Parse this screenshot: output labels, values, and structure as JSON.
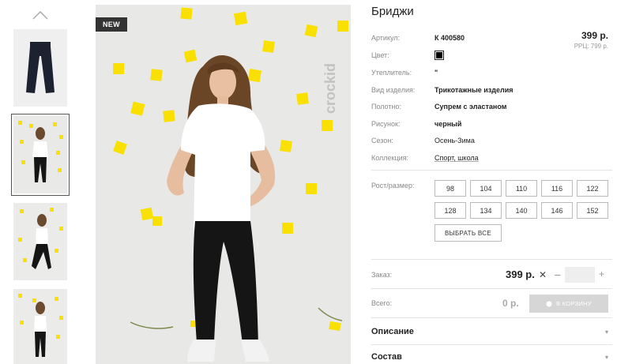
{
  "badge": "NEW",
  "brand_vertical": "crockid",
  "product": {
    "title": "Бриджи",
    "price": "399 р.",
    "rrp": "РРЦ: 799 р."
  },
  "specs": {
    "article_label": "Артикул:",
    "article_value": "К 400580",
    "color_label": "Цвет:",
    "color_hex": "#000000",
    "insulation_label": "Утеплитель:",
    "insulation_value": "\"",
    "type_label": "Вид изделия:",
    "type_value": "Трикотажные изделия",
    "fabric_label": "Полотно:",
    "fabric_value": "Супрем с эластаном",
    "pattern_label": "Рисунок:",
    "pattern_value": "черный",
    "season_label": "Сезон:",
    "season_value": "Осень-Зима",
    "collection_label": "Коллекция:",
    "collection_value": "Спорт, школа"
  },
  "sizes": {
    "label": "Рост/размер:",
    "items": [
      "98",
      "104",
      "110",
      "116",
      "122",
      "128",
      "134",
      "140",
      "146",
      "152"
    ],
    "select_all": "ВЫБРАТЬ ВСЕ"
  },
  "order": {
    "label": "Заказ:",
    "price": "399 р.",
    "times": "✕",
    "minus": "–",
    "quantity": "",
    "plus": "+"
  },
  "total": {
    "label": "Всего:",
    "value": "0 р.",
    "cart_button": "В КОРЗИНУ"
  },
  "accordion": {
    "description": "Описание",
    "composition": "Состав",
    "arrow": "▾"
  },
  "colors": {
    "accent_yellow": "#f9e000",
    "disabled_button": "#d6d6d6"
  }
}
